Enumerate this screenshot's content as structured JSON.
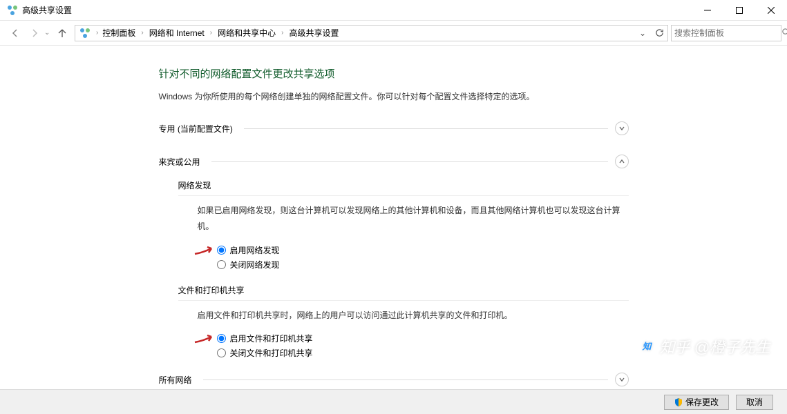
{
  "title": "高级共享设置",
  "breadcrumbs": [
    "控制面板",
    "网络和 Internet",
    "网络和共享中心",
    "高级共享设置"
  ],
  "search_placeholder": "搜索控制面板",
  "heading": "针对不同的网络配置文件更改共享选项",
  "description": "Windows 为你所使用的每个网络创建单独的网络配置文件。你可以针对每个配置文件选择特定的选项。",
  "sections": {
    "private": {
      "label": "专用 (当前配置文件)",
      "expanded": false
    },
    "guest": {
      "label": "来宾或公用",
      "expanded": true,
      "network_discovery": {
        "title": "网络发现",
        "desc": "如果已启用网络发现，则这台计算机可以发现网络上的其他计算机和设备，而且其他网络计算机也可以发现这台计算机。",
        "opt_on": "启用网络发现",
        "opt_off": "关闭网络发现",
        "selected": "on"
      },
      "file_sharing": {
        "title": "文件和打印机共享",
        "desc": "启用文件和打印机共享时，网络上的用户可以访问通过此计算机共享的文件和打印机。",
        "opt_on": "启用文件和打印机共享",
        "opt_off": "关闭文件和打印机共享",
        "selected": "on"
      }
    },
    "all": {
      "label": "所有网络",
      "expanded": false
    }
  },
  "buttons": {
    "save": "保存更改",
    "cancel": "取消"
  },
  "watermark": "知乎 @橙子先生"
}
